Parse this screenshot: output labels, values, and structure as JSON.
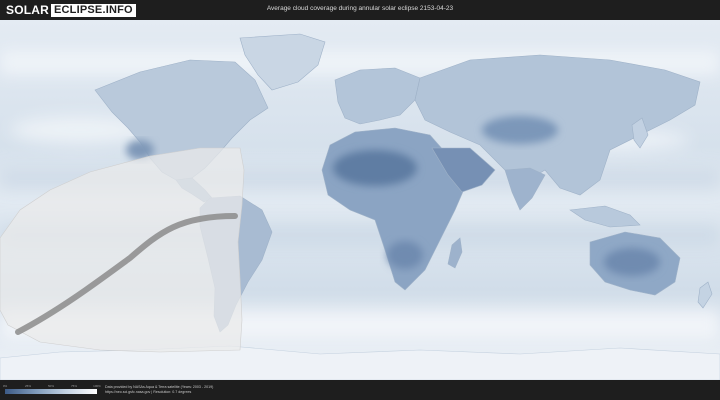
{
  "header": {
    "logo_solar": "SOLAR",
    "logo_rest": "ECLIPSE.INFO",
    "title": "Average cloud coverage during annular solar eclipse 2153-04-23"
  },
  "legend": {
    "ticks": [
      "0%",
      "25%",
      "50%",
      "75%",
      "100%"
    ],
    "colors": [
      "#3d5b86",
      "#ffffff"
    ]
  },
  "credits": {
    "line1": "Data provided by NASAs Aqua & Terra satellite (Years: 2003 - 2019)",
    "line2": "https://neo.sci.gsfc.nasa.gov  |  Resolution: 0.7 degrees"
  },
  "colors": {
    "background": "#1e1e1e",
    "ocean_cloud": "#dbe5ef",
    "clear_sky": "#5f7da3",
    "eclipse_zone": "#ececec",
    "central_path": "#8c8c8c"
  }
}
